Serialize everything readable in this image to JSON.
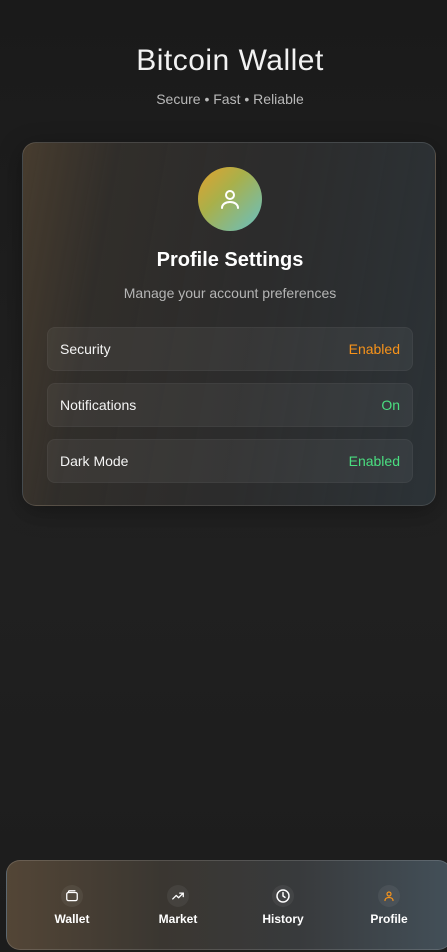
{
  "header": {
    "title": "Bitcoin Wallet",
    "subtitle": "Secure • Fast • Reliable"
  },
  "profile_card": {
    "avatar_icon": "user-icon",
    "title": "Profile Settings",
    "subtitle": "Manage your account preferences",
    "settings": [
      {
        "label": "Security",
        "value": "Enabled",
        "value_color": "#f7931a"
      },
      {
        "label": "Notifications",
        "value": "On",
        "value_color": "#4ade80"
      },
      {
        "label": "Dark Mode",
        "value": "Enabled",
        "value_color": "#4ade80"
      }
    ]
  },
  "bottom_nav": {
    "active_color": "#f7931a",
    "items": [
      {
        "label": "Wallet",
        "icon": "wallet-icon",
        "active": false
      },
      {
        "label": "Market",
        "icon": "trending-up-icon",
        "active": false
      },
      {
        "label": "History",
        "icon": "clock-icon",
        "active": false
      },
      {
        "label": "Profile",
        "icon": "user-icon",
        "active": true
      }
    ]
  }
}
